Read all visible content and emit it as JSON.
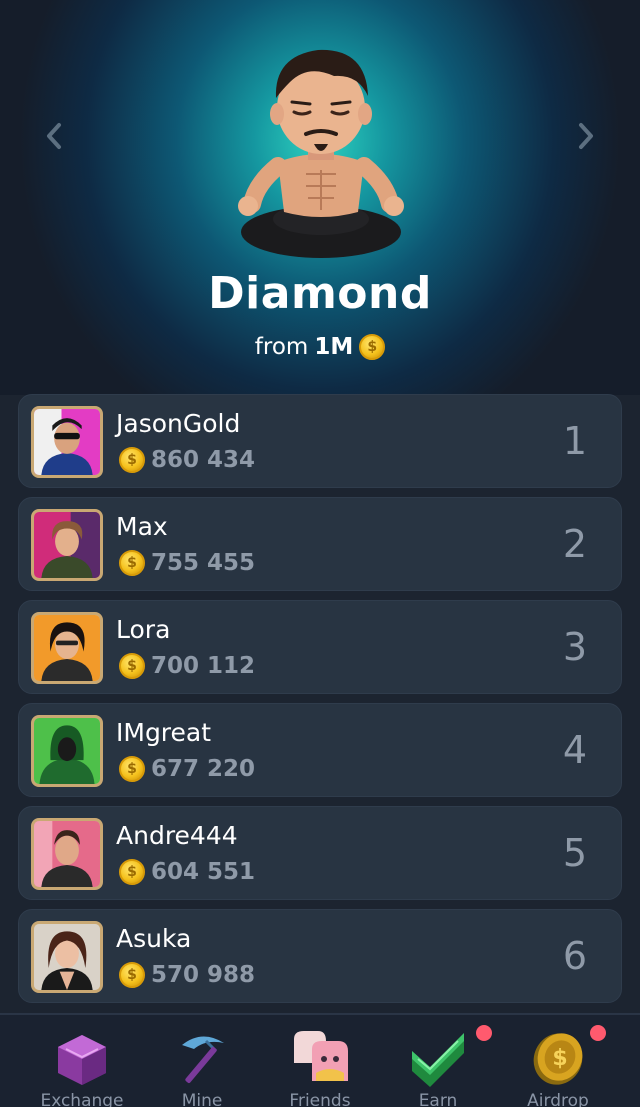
{
  "level": {
    "title": "Diamond",
    "threshold_prefix": "from",
    "threshold_amount": "1M"
  },
  "players": [
    {
      "name": "JasonGold",
      "score": "860 434",
      "rank": "1",
      "avatar_bg": "#e33cc4",
      "shirt": "#1f3d8a"
    },
    {
      "name": "Max",
      "score": "755 455",
      "rank": "2",
      "avatar_bg": "#d02c7a",
      "shirt": "#3a4a2a"
    },
    {
      "name": "Lora",
      "score": "700 112",
      "rank": "3",
      "avatar_bg": "#f29a2a",
      "shirt": "#2b2b2b"
    },
    {
      "name": "IMgreat",
      "score": "677 220",
      "rank": "4",
      "avatar_bg": "#4ec04a",
      "shirt": "#1f6b2e"
    },
    {
      "name": "Andre444",
      "score": "604 551",
      "rank": "5",
      "avatar_bg": "#e56a8a",
      "shirt": "#2a2a2a"
    },
    {
      "name": "Asuka",
      "score": "570 988",
      "rank": "6",
      "avatar_bg": "#d9d2c8",
      "shirt": "#1a1a1a"
    }
  ],
  "nav": {
    "items": [
      {
        "label": "Exchange",
        "icon": "exchange-cube-icon",
        "badge": false
      },
      {
        "label": "Mine",
        "icon": "pickaxe-icon",
        "badge": false
      },
      {
        "label": "Friends",
        "icon": "friends-icon",
        "badge": false
      },
      {
        "label": "Earn",
        "icon": "earn-icon",
        "badge": true
      },
      {
        "label": "Airdrop",
        "icon": "airdrop-coin-icon",
        "badge": true
      }
    ]
  },
  "colors": {
    "badge": "#ff5a6e",
    "coin": "#f5c21d",
    "row_bg": "#283442",
    "muted_text": "#8f9aa8"
  }
}
